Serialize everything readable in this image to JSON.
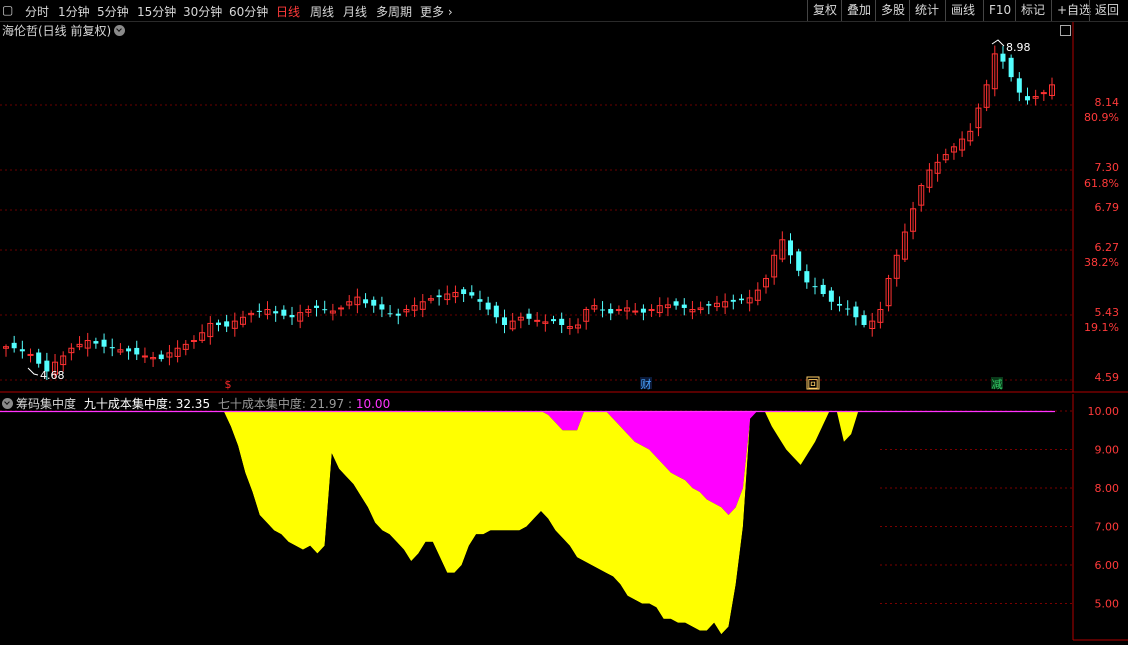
{
  "toolbar": {
    "periods": [
      "分时",
      "1分钟",
      "5分钟",
      "15分钟",
      "30分钟",
      "60分钟",
      "日线",
      "周线",
      "月线",
      "多周期",
      "更多"
    ],
    "active_period": "日线",
    "buttons": [
      "复权",
      "叠加",
      "多股",
      "统计",
      "画线",
      "F10",
      "标记",
      "+自选",
      "返回"
    ]
  },
  "main_chart": {
    "title": "海伦哲(日线 前复权)",
    "price_labels": [
      "8.14",
      "7.30",
      "6.79",
      "6.27",
      "5.43",
      "4.59"
    ],
    "pct_labels": [
      "80.9%",
      "61.8%",
      "38.2%",
      "19.1%"
    ],
    "high_marker": "8.98",
    "low_marker": "4.68",
    "event_markers": [
      {
        "label": "$",
        "color": "#ff2a2a"
      },
      {
        "label": "财",
        "color": "#4aa3ff"
      },
      {
        "label": "回",
        "color": "#ffcc66"
      },
      {
        "label": "减",
        "color": "#33cc66"
      }
    ]
  },
  "indicator": {
    "name": "筹码集中度",
    "line1_label": "九十成本集中度:",
    "line1_value": "32.35",
    "line2_label": "七十成本集中度:",
    "line2_value": "21.97",
    "line3_value": "10.00",
    "axis_labels": [
      "10.00",
      "9.00",
      "8.00",
      "7.00",
      "6.00",
      "5.00"
    ],
    "colors": {
      "line1": "#ffff00",
      "line2": "#ff00ff",
      "axis": "#c00000",
      "grid": "#7a0000"
    }
  },
  "chart_data": {
    "type": "area",
    "title": "筹码集中度",
    "ylim": [
      4.0,
      10.0
    ],
    "series": [
      {
        "name": "九十成本集中度",
        "color": "#ffff00",
        "values": [
          10,
          10,
          10,
          10,
          10,
          10,
          10,
          10,
          10,
          10,
          10,
          10,
          10,
          10,
          10,
          10,
          10,
          10,
          10,
          10,
          10,
          10,
          10,
          10,
          10,
          10,
          10,
          10,
          10,
          10,
          10,
          10,
          9.6,
          9.1,
          8.4,
          7.9,
          7.3,
          7.1,
          6.9,
          6.8,
          6.6,
          6.5,
          6.4,
          6.5,
          6.3,
          6.5,
          8.9,
          8.5,
          8.3,
          8.1,
          7.8,
          7.5,
          7.1,
          6.9,
          6.8,
          6.6,
          6.4,
          6.1,
          6.3,
          6.6,
          6.6,
          6.2,
          5.8,
          5.8,
          6.0,
          6.5,
          6.8,
          6.8,
          6.9,
          6.9,
          6.9,
          6.9,
          6.9,
          7.0,
          7.2,
          7.4,
          7.2,
          6.9,
          6.7,
          6.5,
          6.2,
          6.1,
          6.0,
          5.9,
          5.8,
          5.7,
          5.5,
          5.2,
          5.1,
          5.0,
          5.0,
          4.9,
          4.6,
          4.6,
          4.5,
          4.5,
          4.4,
          4.3,
          4.3,
          4.5,
          4.2,
          4.4,
          5.5,
          7.0,
          9.8,
          10,
          10,
          10,
          10,
          10,
          10,
          10,
          10,
          10,
          10,
          10,
          10,
          10,
          10,
          10,
          10,
          10,
          10
        ]
      },
      {
        "name": "七十成本集中度",
        "color": "#ff00ff",
        "values": [
          10,
          10,
          10,
          10,
          10,
          10,
          10,
          10,
          10,
          10,
          10,
          10,
          10,
          10,
          10,
          10,
          10,
          10,
          10,
          10,
          10,
          10,
          10,
          10,
          10,
          10,
          10,
          10,
          10,
          10,
          10,
          10,
          10,
          10,
          10,
          10,
          10,
          10,
          10,
          10,
          10,
          10,
          10,
          10,
          10,
          10,
          10,
          10,
          10,
          10,
          10,
          10,
          10,
          10,
          10,
          10,
          10,
          10,
          10,
          10,
          10,
          10,
          10,
          10,
          10,
          10,
          10,
          10,
          10,
          10,
          10,
          10,
          10,
          10,
          10,
          10,
          9.9,
          9.7,
          9.5,
          9.5,
          9.5,
          10,
          10,
          10,
          10,
          9.8,
          9.6,
          9.4,
          9.2,
          9.1,
          9.0,
          8.8,
          8.6,
          8.4,
          8.3,
          8.2,
          8.0,
          7.9,
          7.7,
          7.6,
          7.5,
          7.3,
          7.5,
          8.0,
          9.8,
          10,
          10,
          10,
          10,
          10,
          10,
          10,
          10,
          10,
          10,
          10,
          10,
          10,
          10,
          10,
          10,
          10,
          10
        ]
      },
      {
        "name": "",
        "color": "#ffff00",
        "values": [
          null,
          null,
          null,
          null,
          null,
          null,
          null,
          null,
          null,
          null,
          null,
          null,
          null,
          null,
          null,
          null,
          null,
          null,
          null,
          null,
          null,
          null,
          null,
          null,
          null,
          null,
          null,
          null,
          null,
          null,
          null,
          null,
          null,
          null,
          null,
          null,
          null,
          null,
          null,
          null,
          null,
          null,
          null,
          null,
          null,
          null,
          null,
          null,
          null,
          null,
          null,
          null,
          null,
          null,
          null,
          null,
          null,
          null,
          null,
          null,
          null,
          null,
          null,
          null,
          null,
          null,
          null,
          null,
          null,
          null,
          null,
          null,
          null,
          null,
          null,
          null,
          null,
          null,
          null,
          null,
          null,
          null,
          null,
          null,
          null,
          null,
          null,
          null,
          null,
          null,
          null,
          null,
          null,
          null,
          null,
          null,
          null,
          null,
          null,
          null,
          null,
          null,
          null,
          null,
          null,
          10,
          10,
          9.6,
          9.3,
          9.0,
          8.8,
          8.6,
          8.9,
          9.2,
          9.6,
          10,
          10,
          9.2,
          9.4,
          10,
          10
        ]
      }
    ]
  }
}
